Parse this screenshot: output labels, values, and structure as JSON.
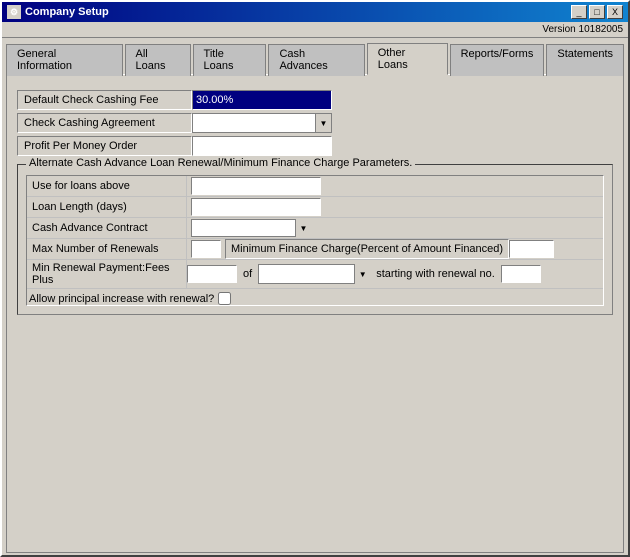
{
  "window": {
    "title": "Company Setup",
    "version": "Version 10182005"
  },
  "title_buttons": {
    "minimize": "_",
    "maximize": "□",
    "close": "X"
  },
  "tabs": [
    {
      "id": "general",
      "label": "General Information",
      "active": false
    },
    {
      "id": "all_loans",
      "label": "All Loans",
      "active": false
    },
    {
      "id": "title_loans",
      "label": "Title Loans",
      "active": false
    },
    {
      "id": "cash_advances",
      "label": "Cash Advances",
      "active": false
    },
    {
      "id": "other_loans",
      "label": "Other Loans",
      "active": true
    },
    {
      "id": "reports_forms",
      "label": "Reports/Forms",
      "active": false
    },
    {
      "id": "statements",
      "label": "Statements",
      "active": false
    }
  ],
  "fields": {
    "default_check_label": "Default Check Cashing Fee",
    "default_check_value": "30.00%",
    "check_cashing_agreement_label": "Check Cashing Agreement",
    "profit_per_money_order_label": "Profit Per Money Order"
  },
  "group": {
    "title": "Alternate Cash Advance Loan Renewal/Minimum Finance Charge Parameters.",
    "use_for_loans_label": "Use for loans above",
    "loan_length_label": "Loan Length (days)",
    "cash_advance_contract_label": "Cash Advance Contract",
    "max_renewals_label": "Max Number of Renewals",
    "min_finance_label": "Minimum Finance Charge(Percent of Amount Financed)",
    "min_renewal_label": "Min Renewal Payment:Fees Plus",
    "of_text": "of",
    "starting_text": "starting with renewal no.",
    "allow_principal_label": "Allow principal increase with renewal?"
  }
}
